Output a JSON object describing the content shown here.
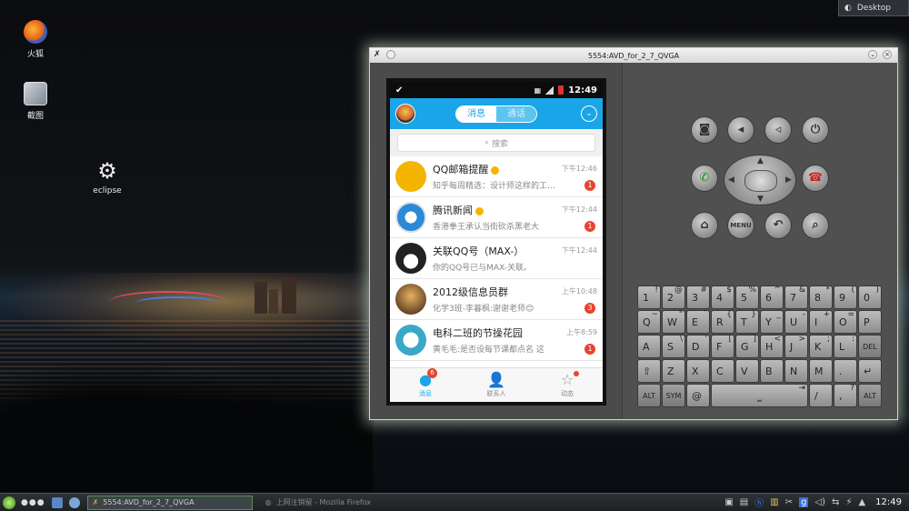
{
  "desktop": {
    "icons": [
      {
        "label": "火狐",
        "icon": "firefox-icon"
      },
      {
        "label": "截图",
        "icon": "screenshot-icon"
      },
      {
        "label": "eclipse",
        "icon": "gear-icon"
      }
    ],
    "desktop_button": "Desktop"
  },
  "emulator": {
    "title": "5554:AVD_for_2_7_QVGA",
    "status_time": "12:49"
  },
  "qq": {
    "tabs": {
      "messages": "消息",
      "calls": "通话"
    },
    "search_placeholder": "搜索",
    "conversations": [
      {
        "name": "QQ邮箱提醒",
        "verified": true,
        "preview": "知乎每周精选：设计师这样的工…",
        "time": "下午12:46",
        "badge": "1",
        "avatar_color": "#f5b400"
      },
      {
        "name": "腾讯新闻",
        "verified": true,
        "preview": "香港拳王承认当街砍杀黑老大",
        "time": "下午12:44",
        "badge": "1",
        "avatar_color": "#2b8ad8"
      },
      {
        "name": "关联QQ号（MAX-）",
        "verified": false,
        "preview": "你的QQ号已与MAX-关联。",
        "time": "下午12:44",
        "badge": "",
        "avatar_color": "#222222"
      },
      {
        "name": "2012级信息员群",
        "verified": false,
        "preview": "化学3班-李暮枫:谢谢老师😊",
        "time": "上午10:48",
        "badge": "3",
        "avatar_color": "#6a4a2a"
      },
      {
        "name": "电科二班的节操花园",
        "verified": false,
        "preview": "黄毛毛:是否设每节课都点名 这",
        "time": "上午8:59",
        "badge": "1",
        "avatar_color": "#3aa8c8"
      }
    ],
    "bottom_tabs": [
      {
        "label": "消息",
        "badge": "6"
      },
      {
        "label": "联系人",
        "badge": ""
      },
      {
        "label": "动态",
        "badge": "dot"
      }
    ]
  },
  "keyboard": {
    "rows": [
      [
        {
          "k": "1",
          "a": "!"
        },
        {
          "k": "2",
          "a": "@"
        },
        {
          "k": "3",
          "a": "#"
        },
        {
          "k": "4",
          "a": "$"
        },
        {
          "k": "5",
          "a": "%"
        },
        {
          "k": "6",
          "a": "^"
        },
        {
          "k": "7",
          "a": "&"
        },
        {
          "k": "8",
          "a": "*"
        },
        {
          "k": "9",
          "a": "("
        },
        {
          "k": "0",
          "a": ")"
        }
      ],
      [
        {
          "k": "Q",
          "a": "~"
        },
        {
          "k": "W",
          "a": "\""
        },
        {
          "k": "E",
          "a": "`"
        },
        {
          "k": "R",
          "a": "{"
        },
        {
          "k": "T",
          "a": "}"
        },
        {
          "k": "Y",
          "a": "_"
        },
        {
          "k": "U",
          "a": "-"
        },
        {
          "k": "I",
          "a": "+"
        },
        {
          "k": "O",
          "a": "="
        },
        {
          "k": "P",
          "a": ""
        }
      ],
      [
        {
          "k": "A",
          "a": ""
        },
        {
          "k": "S",
          "a": "\\"
        },
        {
          "k": "D",
          "a": "'"
        },
        {
          "k": "F",
          "a": "["
        },
        {
          "k": "G",
          "a": "]"
        },
        {
          "k": "H",
          "a": "<"
        },
        {
          "k": "J",
          "a": ">"
        },
        {
          "k": "K",
          "a": ";"
        },
        {
          "k": "L",
          "a": ":"
        },
        {
          "k": "DEL",
          "a": ""
        }
      ],
      [
        {
          "k": "⇧",
          "a": ""
        },
        {
          "k": "Z",
          "a": ""
        },
        {
          "k": "X",
          "a": ""
        },
        {
          "k": "C",
          "a": ""
        },
        {
          "k": "V",
          "a": ""
        },
        {
          "k": "B",
          "a": ""
        },
        {
          "k": "N",
          "a": ""
        },
        {
          "k": "M",
          "a": ""
        },
        {
          "k": ".",
          "a": ""
        },
        {
          "k": "↵",
          "a": ""
        }
      ],
      [
        {
          "k": "ALT",
          "a": ""
        },
        {
          "k": "SYM",
          "a": ""
        },
        {
          "k": "@",
          "a": ""
        },
        {
          "k": "⎵",
          "a": "⇥"
        },
        {
          "k": "/",
          "a": ""
        },
        {
          "k": ",",
          "a": "?"
        },
        {
          "k": "ALT",
          "a": ""
        }
      ]
    ],
    "hw_menu_label": "MENU"
  },
  "taskbar": {
    "active_task": "5554:AVD_for_2_7_QVGA",
    "inactive_task": "上网注销留 - Mozilla Firefox",
    "clock": "12:49"
  }
}
